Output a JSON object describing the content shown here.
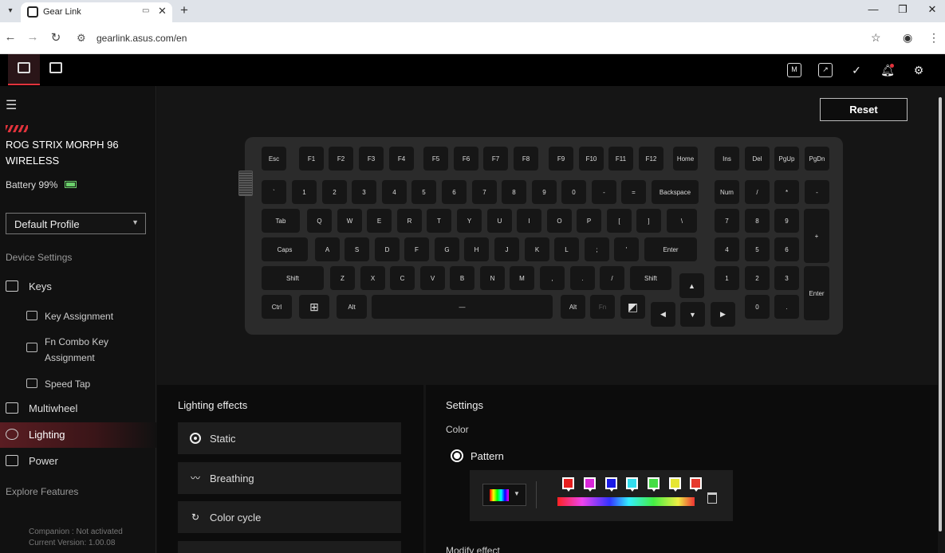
{
  "browser": {
    "tab_title": "Gear Link",
    "url": "gearlink.asus.com/en",
    "new_tab": "+",
    "minimize": "—",
    "restore": "❐",
    "close": "✕"
  },
  "sidebar": {
    "device_name": "ROG STRIX MORPH 96 WIRELESS",
    "battery": "Battery 99%",
    "battery_level": 0.99,
    "profile": "Default Profile",
    "device_settings_label": "Device Settings",
    "items": [
      {
        "label": "Keys",
        "icon": "keyboard-icon"
      },
      {
        "label": "Multiwheel",
        "icon": "multiwheel-icon"
      },
      {
        "label": "Lighting",
        "icon": "lighting-icon",
        "active": true
      },
      {
        "label": "Power",
        "icon": "battery-icon"
      }
    ],
    "sub_items": [
      {
        "label": "Key Assignment",
        "icon": "keyboard-icon"
      },
      {
        "label": "Fn Combo Key Assignment",
        "icon": "fn-key-icon"
      },
      {
        "label": "Speed Tap",
        "icon": "speed-tap-icon"
      }
    ],
    "explore_label": "Explore Features",
    "companion": "Companion : Not activated",
    "version": "Current Version: 1.00.08"
  },
  "main": {
    "reset_label": "Reset",
    "keyboard": {
      "row0": [
        "Esc",
        "F1",
        "F2",
        "F3",
        "F4",
        "F5",
        "F6",
        "F7",
        "F8",
        "F9",
        "F10",
        "F11",
        "F12",
        "Home",
        "Ins",
        "Del",
        "PgUp",
        "PgDn"
      ],
      "row1": [
        "`",
        "1",
        "2",
        "3",
        "4",
        "5",
        "6",
        "7",
        "8",
        "9",
        "0",
        "-",
        "=",
        "Backspace",
        "Num",
        "/",
        "*",
        "-"
      ],
      "row2": [
        "Tab",
        "Q",
        "W",
        "E",
        "R",
        "T",
        "Y",
        "U",
        "I",
        "O",
        "P",
        "[",
        "]",
        "\\",
        "7",
        "8",
        "9",
        "+"
      ],
      "row3": [
        "Caps",
        "A",
        "S",
        "D",
        "F",
        "G",
        "H",
        "J",
        "K",
        "L",
        ";",
        "'",
        "Enter",
        "4",
        "5",
        "6"
      ],
      "row4": [
        "Shift",
        "Z",
        "X",
        "C",
        "V",
        "B",
        "N",
        "M",
        ",",
        ".",
        "/",
        "Shift",
        "▲",
        "1",
        "2",
        "3",
        "Enter"
      ],
      "row5": [
        "Ctrl",
        "⊞",
        "Alt",
        "—",
        "Alt",
        "Fn",
        "◩",
        "◀",
        "▼",
        "▶",
        "0",
        "."
      ]
    }
  },
  "lighting": {
    "title": "Lighting effects",
    "effects": [
      {
        "label": "Static",
        "icon": "static-icon"
      },
      {
        "label": "Breathing",
        "icon": "breathing-icon"
      },
      {
        "label": "Color cycle",
        "icon": "color-cycle-icon"
      }
    ]
  },
  "settings": {
    "title": "Settings",
    "color_label": "Color",
    "pattern_label": "Pattern",
    "modify_label": "Modify effect",
    "stops": [
      "#e61e1e",
      "#d926d9",
      "#1a1ae6",
      "#33ddee",
      "#44dd44",
      "#e6e633",
      "#e63a2e"
    ]
  },
  "colors": {
    "accent": "#e2333c"
  }
}
